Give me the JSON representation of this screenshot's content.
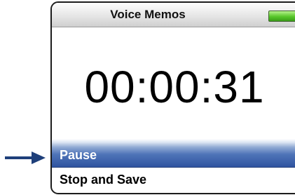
{
  "window": {
    "title": "Voice Memos"
  },
  "status": {
    "battery_icon": "battery-full-icon",
    "battery_color": "#57c62a"
  },
  "recording": {
    "elapsed_time": "00:00:31"
  },
  "menu": {
    "items": [
      {
        "label": "Pause",
        "selected": true
      },
      {
        "label": "Stop and Save",
        "selected": false
      }
    ],
    "selection_color": "#3a62ad"
  },
  "pointer": {
    "icon": "right-arrow-icon",
    "color": "#1e3f7a"
  }
}
